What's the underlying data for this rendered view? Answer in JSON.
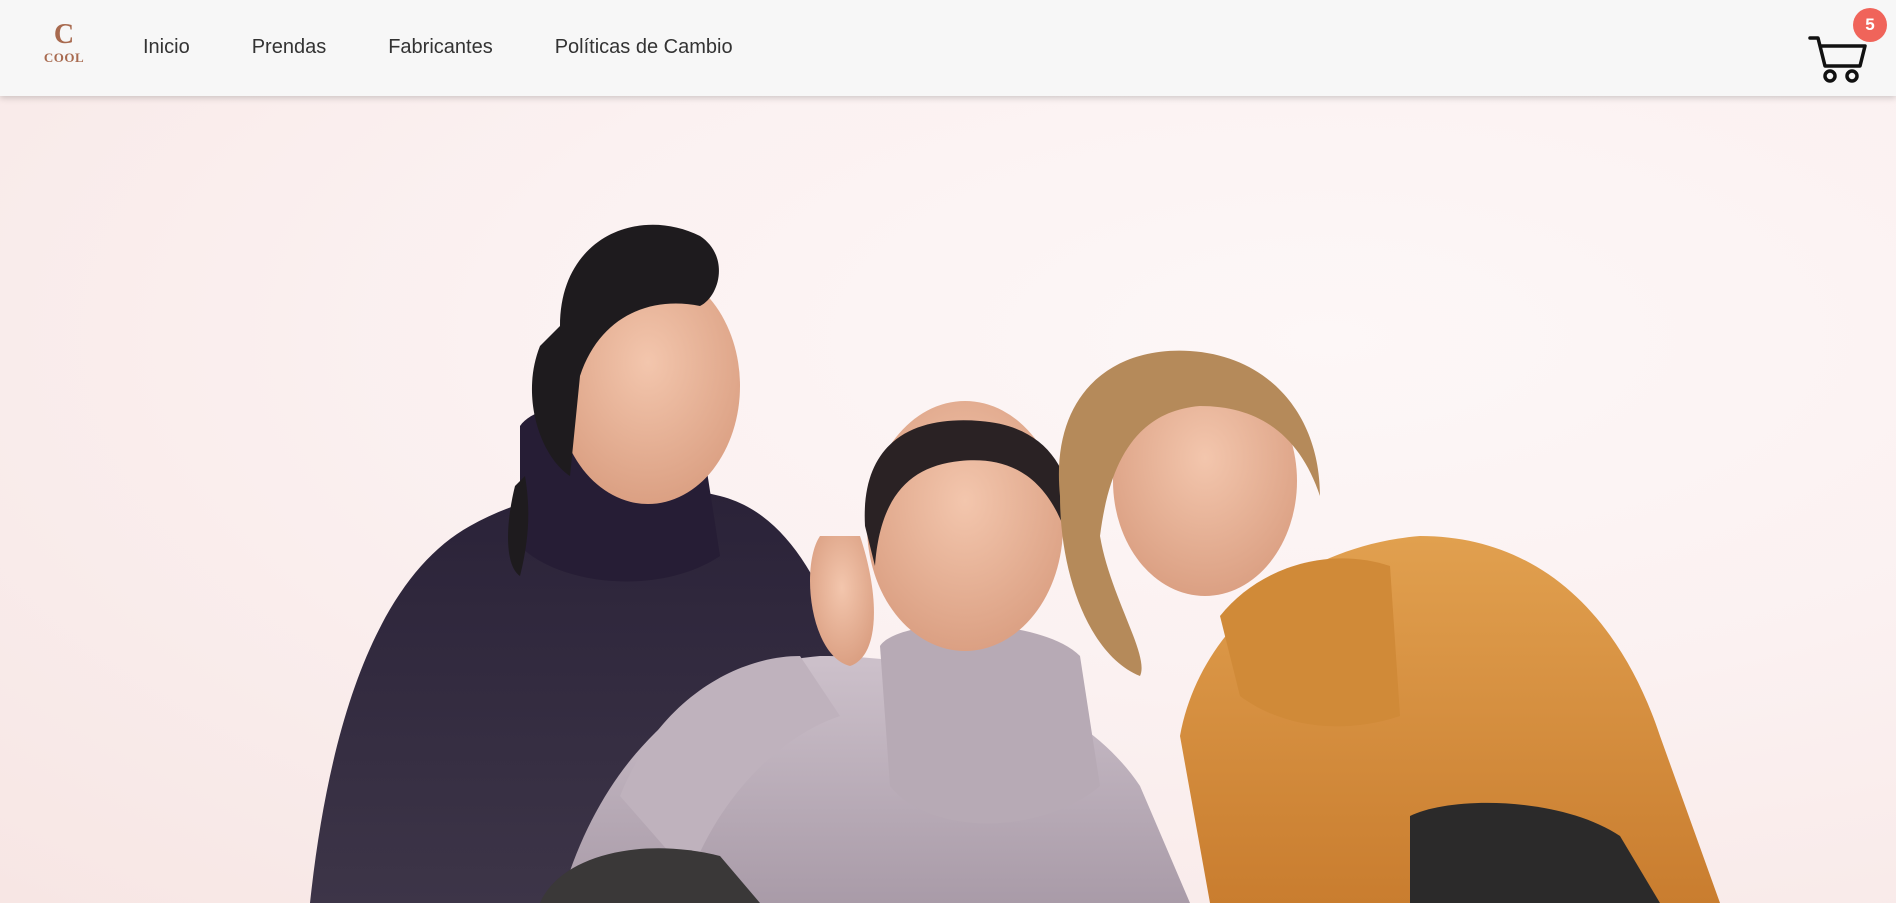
{
  "brand": {
    "logo_mark": "C",
    "logo_text": "COOL",
    "logo_color": "#a86a4f"
  },
  "nav": {
    "items": [
      {
        "label": "Inicio"
      },
      {
        "label": "Prendas"
      },
      {
        "label": "Fabricantes"
      },
      {
        "label": "Políticas de Cambio"
      }
    ]
  },
  "cart": {
    "icon": "shopping-cart-icon",
    "count": "5",
    "badge_color": "#f0645a"
  },
  "hero": {
    "image": "three-women-in-sweaters-photo",
    "colors": {
      "background": "#fbf1f1",
      "sweater_left": "#2e2540",
      "sweater_middle": "#c4b7c2",
      "sweater_right": "#d8913f"
    }
  }
}
